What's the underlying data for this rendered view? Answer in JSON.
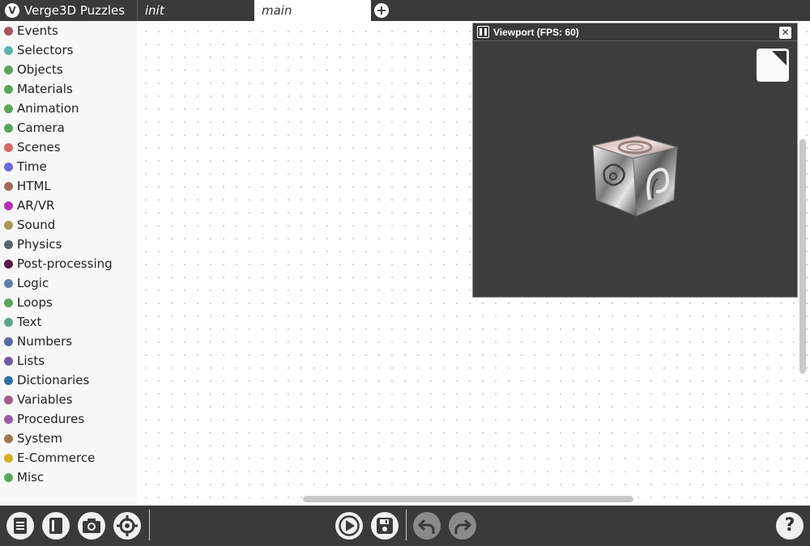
{
  "app": {
    "title": "Verge3D Puzzles",
    "logo_glyph": "V"
  },
  "tabs": [
    {
      "label": "init",
      "active": false
    },
    {
      "label": "main",
      "active": true
    }
  ],
  "add_tab": {
    "icon": "plus-circle-icon",
    "glyph": "+"
  },
  "sidebar": {
    "categories": [
      {
        "label": "Events",
        "color": "#a8545c"
      },
      {
        "label": "Selectors",
        "color": "#5ab3b3"
      },
      {
        "label": "Objects",
        "color": "#5ba55b"
      },
      {
        "label": "Materials",
        "color": "#5ba55b"
      },
      {
        "label": "Animation",
        "color": "#5ba55b"
      },
      {
        "label": "Camera",
        "color": "#5ba55b"
      },
      {
        "label": "Scenes",
        "color": "#d96666"
      },
      {
        "label": "Time",
        "color": "#6a6ad9"
      },
      {
        "label": "HTML",
        "color": "#a8685c"
      },
      {
        "label": "AR/VR",
        "color": "#b033b0"
      },
      {
        "label": "Sound",
        "color": "#a89a55"
      },
      {
        "label": "Physics",
        "color": "#5f6370"
      },
      {
        "label": "Post-processing",
        "color": "#5a1a4a"
      },
      {
        "label": "Logic",
        "color": "#5b80a5"
      },
      {
        "label": "Loops",
        "color": "#5ba55b"
      },
      {
        "label": "Text",
        "color": "#5ba58c"
      },
      {
        "label": "Numbers",
        "color": "#5b67a5"
      },
      {
        "label": "Lists",
        "color": "#745ba5"
      },
      {
        "label": "Dictionaries",
        "color": "#2f6fa5"
      },
      {
        "label": "Variables",
        "color": "#a55b80"
      },
      {
        "label": "Procedures",
        "color": "#995ba5"
      },
      {
        "label": "System",
        "color": "#a07850"
      },
      {
        "label": "E-Commerce",
        "color": "#d4b020"
      },
      {
        "label": "Misc",
        "color": "#5ba55b"
      }
    ]
  },
  "viewport": {
    "title": "Viewport (FPS: 60)",
    "close_glyph": "✕",
    "background": "#3d3d3d"
  },
  "toolbar": {
    "left_icons": [
      "manual-book-icon",
      "library-icon",
      "screenshot-camera-icon",
      "locate-target-icon"
    ],
    "center_icons": [
      "run-play-icon",
      "save-disk-icon"
    ],
    "history_icons": [
      "undo-icon",
      "redo-icon"
    ],
    "help_glyph": "?"
  },
  "colors": {
    "bar": "#3a3a3a",
    "sidebar": "#f8f8f8",
    "button": "#f0f0f0",
    "button_disabled": "#8a8a8a"
  }
}
